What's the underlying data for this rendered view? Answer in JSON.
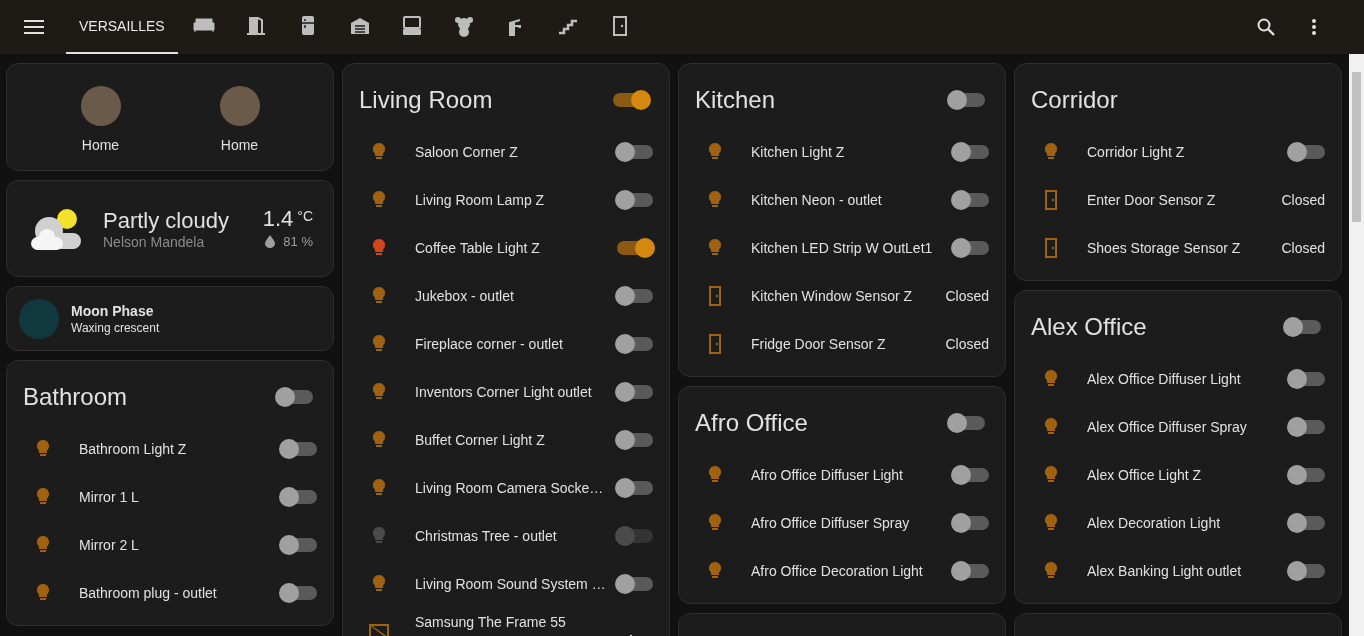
{
  "toolbar": {
    "tabs": [
      {
        "label": "VERSAILLES",
        "selected": true
      },
      {
        "selected": false
      },
      {
        "selected": false
      },
      {
        "selected": false
      },
      {
        "selected": false
      },
      {
        "selected": false
      },
      {
        "selected": false
      },
      {
        "selected": false
      },
      {
        "selected": false
      },
      {
        "selected": false
      }
    ]
  },
  "columns": [
    [
      {
        "kind": "persons",
        "people": [
          {
            "state": "Home"
          },
          {
            "state": "Home"
          }
        ]
      },
      {
        "kind": "weather",
        "condition": "Partly cloudy",
        "location": "Nelson Mandela",
        "temperature": "1.4",
        "unit": "°C",
        "humidity": "81 %"
      },
      {
        "kind": "moon",
        "title": "Moon Phase",
        "state": "Waxing crescent"
      },
      {
        "kind": "room",
        "title": "Bathroom",
        "on": false,
        "rows": [
          {
            "kind": "switch",
            "name": "Bathroom Light Z",
            "on": false,
            "disabled": false
          },
          {
            "kind": "switch",
            "name": "Mirror 1 L",
            "on": false,
            "disabled": false
          },
          {
            "kind": "switch",
            "name": "Mirror 2 L",
            "on": false,
            "disabled": false
          },
          {
            "kind": "switch",
            "name": "Bathroom plug - outlet",
            "on": false,
            "disabled": false
          }
        ]
      }
    ],
    [
      {
        "kind": "room",
        "title": "Living Room",
        "on": true,
        "rows": [
          {
            "kind": "switch",
            "name": "Saloon Corner Z",
            "on": false,
            "disabled": false
          },
          {
            "kind": "switch",
            "name": "Living Room Lamp Z",
            "on": false,
            "disabled": false
          },
          {
            "kind": "switch",
            "name": "Coffee Table Light Z",
            "on": true,
            "disabled": false
          },
          {
            "kind": "switch",
            "name": "Jukebox - outlet",
            "on": false,
            "disabled": false
          },
          {
            "kind": "switch",
            "name": "Fireplace corner - outlet",
            "on": false,
            "disabled": false
          },
          {
            "kind": "switch",
            "name": "Inventors Corner Light outlet",
            "on": false,
            "disabled": false
          },
          {
            "kind": "switch",
            "name": "Buffet Corner Light Z",
            "on": false,
            "disabled": false
          },
          {
            "kind": "switch",
            "name": "Living Room Camera Socke…",
            "on": false,
            "disabled": false
          },
          {
            "kind": "switch",
            "name": "Christmas Tree - outlet",
            "on": false,
            "disabled": true
          },
          {
            "kind": "switch",
            "name": "Living Room Sound System …",
            "on": false,
            "disabled": false
          },
          {
            "kind": "button",
            "name": "Samsung The Frame 55"
          }
        ]
      }
    ],
    [
      {
        "kind": "room",
        "title": "Kitchen",
        "on": false,
        "rows": [
          {
            "kind": "switch",
            "name": "Kitchen Light Z",
            "on": false,
            "disabled": false
          },
          {
            "kind": "switch",
            "name": "Kitchen Neon - outlet",
            "on": false,
            "disabled": false
          },
          {
            "kind": "switch",
            "name": "Kitchen LED Strip W OutLet1",
            "on": false,
            "disabled": false
          },
          {
            "kind": "sensor",
            "name": "Kitchen Window Sensor Z",
            "state": "Closed"
          },
          {
            "kind": "sensor",
            "name": "Fridge Door Sensor Z",
            "state": "Closed"
          }
        ]
      },
      {
        "kind": "room",
        "title": "Afro Office",
        "on": false,
        "rows": [
          {
            "kind": "switch",
            "name": "Afro Office Diffuser Light",
            "on": false,
            "disabled": false
          },
          {
            "kind": "switch",
            "name": "Afro Office Diffuser Spray",
            "on": false,
            "disabled": false
          },
          {
            "kind": "switch",
            "name": "Afro Office Decoration Light",
            "on": false,
            "disabled": false
          }
        ]
      },
      {
        "kind": "room"
      }
    ],
    [
      {
        "kind": "room",
        "title": "Corridor",
        "rows": [
          {
            "kind": "switch",
            "name": "Corridor Light Z",
            "on": false,
            "disabled": false
          },
          {
            "kind": "sensor",
            "name": "Enter Door Sensor Z",
            "state": "Closed"
          },
          {
            "kind": "sensor",
            "name": "Shoes Storage Sensor Z",
            "state": "Closed"
          }
        ]
      },
      {
        "kind": "room",
        "title": "Alex Office",
        "on": false,
        "rows": [
          {
            "kind": "switch",
            "name": "Alex Office Diffuser Light",
            "on": false,
            "disabled": false
          },
          {
            "kind": "switch",
            "name": "Alex Office Diffuser Spray",
            "on": false,
            "disabled": false
          },
          {
            "kind": "switch",
            "name": "Alex Office Light Z",
            "on": false,
            "disabled": false
          },
          {
            "kind": "switch",
            "name": "Alex Decoration Light",
            "on": false,
            "disabled": false
          },
          {
            "kind": "switch",
            "name": "Alex Banking Light outlet",
            "on": false,
            "disabled": false
          }
        ]
      },
      {
        "kind": "room"
      }
    ]
  ]
}
